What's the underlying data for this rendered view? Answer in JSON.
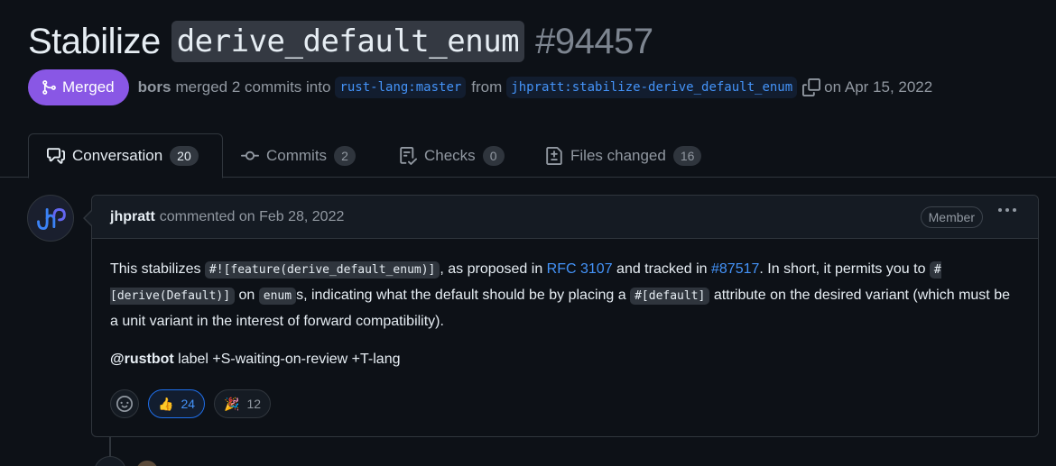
{
  "pr": {
    "title": "Stabilize",
    "title_code": "derive_default_enum",
    "number": "#94457",
    "status": "Merged",
    "status_color": "#8957e5",
    "merger": "bors",
    "merge_text": "merged 2 commits into",
    "base_branch": "rust-lang:master",
    "from_text": "from",
    "head_branch": "jhpratt:stabilize-derive_default_enum",
    "date_text": "on Apr 15, 2022"
  },
  "tabs": [
    {
      "label": "Conversation",
      "count": "20",
      "icon": "comment-discussion-icon"
    },
    {
      "label": "Commits",
      "count": "2",
      "icon": "commit-icon"
    },
    {
      "label": "Checks",
      "count": "0",
      "icon": "checklist-icon"
    },
    {
      "label": "Files changed",
      "count": "16",
      "icon": "file-diff-icon"
    }
  ],
  "comment": {
    "author": "jhpratt",
    "action": "commented on Feb 28, 2022",
    "role": "Member",
    "body": {
      "t1": "This stabilizes ",
      "c1": "#![feature(derive_default_enum)]",
      "t2": ", as proposed in ",
      "l1": "RFC 3107",
      "t3": " and tracked in ",
      "l2": "#87517",
      "t4": ". In short, it permits you to ",
      "c2": "#[derive(Default)]",
      "t5": " on ",
      "c3": "enum",
      "t6": "s, indicating what the default should be by placing a ",
      "c4": "#[default]",
      "t7": " attribute on the desired variant (which must be a unit variant in the interest of forward compatibility).",
      "mention": "@rustbot",
      "t8": " label +S-waiting-on-review +T-lang"
    },
    "reactions": [
      {
        "emoji": "👍",
        "count": "24",
        "selected": true
      },
      {
        "emoji": "🎉",
        "count": "12",
        "selected": false
      }
    ]
  }
}
